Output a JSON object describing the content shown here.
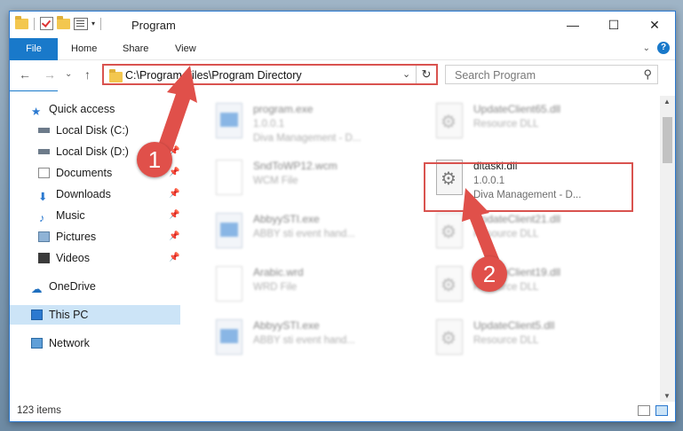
{
  "window": {
    "title": "Program",
    "controls": {
      "minimize": "—",
      "maximize": "☐",
      "close": "✕"
    }
  },
  "ribbon": {
    "tabs": [
      "File",
      "Home",
      "Share",
      "View"
    ]
  },
  "navbar": {
    "back": "←",
    "forward": "→",
    "up_caret": "⌄",
    "up": "↑",
    "address": "C:\\Program Files\\Program Directory",
    "address_dropdown": "⌄",
    "refresh": "↻",
    "search_placeholder": "Search Program"
  },
  "sidebar": {
    "items": [
      {
        "label": "Quick access",
        "icon": "star-icon",
        "pinned": false
      },
      {
        "label": "Local Disk (C:)",
        "icon": "drive-icon",
        "pinned": true
      },
      {
        "label": "Local Disk (D:)",
        "icon": "drive-icon",
        "pinned": true
      },
      {
        "label": "Documents",
        "icon": "documents-icon",
        "pinned": true
      },
      {
        "label": "Downloads",
        "icon": "download-icon",
        "pinned": true
      },
      {
        "label": "Music",
        "icon": "music-icon",
        "pinned": true
      },
      {
        "label": "Pictures",
        "icon": "pictures-icon",
        "pinned": true
      },
      {
        "label": "Videos",
        "icon": "videos-icon",
        "pinned": true
      },
      {
        "label": "OneDrive",
        "icon": "cloud-icon",
        "pinned": false
      },
      {
        "label": "This PC",
        "icon": "pc-icon",
        "pinned": false
      },
      {
        "label": "Network",
        "icon": "network-icon",
        "pinned": false
      }
    ],
    "selected": "This PC"
  },
  "files": [
    {
      "name": "program.exe",
      "line1": "1.0.0.1",
      "line2": "Diva Management - D...",
      "icon": "program-exe-icon"
    },
    {
      "name": "UpdateClient65.dll",
      "line1": "Resource DLL",
      "line2": "",
      "icon": "dll-icon"
    },
    {
      "name": "SndToWP12.wcm",
      "line1": "WCM File",
      "line2": "",
      "icon": "file-icon"
    },
    {
      "name": "ditaski.dll",
      "line1": "1.0.0.1",
      "line2": "Diva Management - D...",
      "icon": "dll-icon"
    },
    {
      "name": "AbbyySTI.exe",
      "line1": "ABBY sti event hand...",
      "line2": "",
      "icon": "exe-icon"
    },
    {
      "name": "UpdateClient21.dll",
      "line1": "Resource DLL",
      "line2": "",
      "icon": "dll-icon"
    },
    {
      "name": "Arabic.wrd",
      "line1": "WRD File",
      "line2": "",
      "icon": "file-icon"
    },
    {
      "name": "UpdateClient19.dll",
      "line1": "Resource DLL",
      "line2": "",
      "icon": "dll-icon"
    },
    {
      "name": "AbbyySTI.exe",
      "line1": "ABBY sti event hand...",
      "line2": "",
      "icon": "exe-icon"
    },
    {
      "name": "UpdateClient5.dll",
      "line1": "Resource DLL",
      "line2": "",
      "icon": "dll-icon"
    }
  ],
  "status": {
    "items_count": "123 items"
  },
  "annotations": {
    "marker1": "1",
    "marker2": "2",
    "color": "#e0504a"
  },
  "colors": {
    "accent": "#1979ca",
    "highlight": "#d9534f",
    "selection": "#cce4f7"
  }
}
